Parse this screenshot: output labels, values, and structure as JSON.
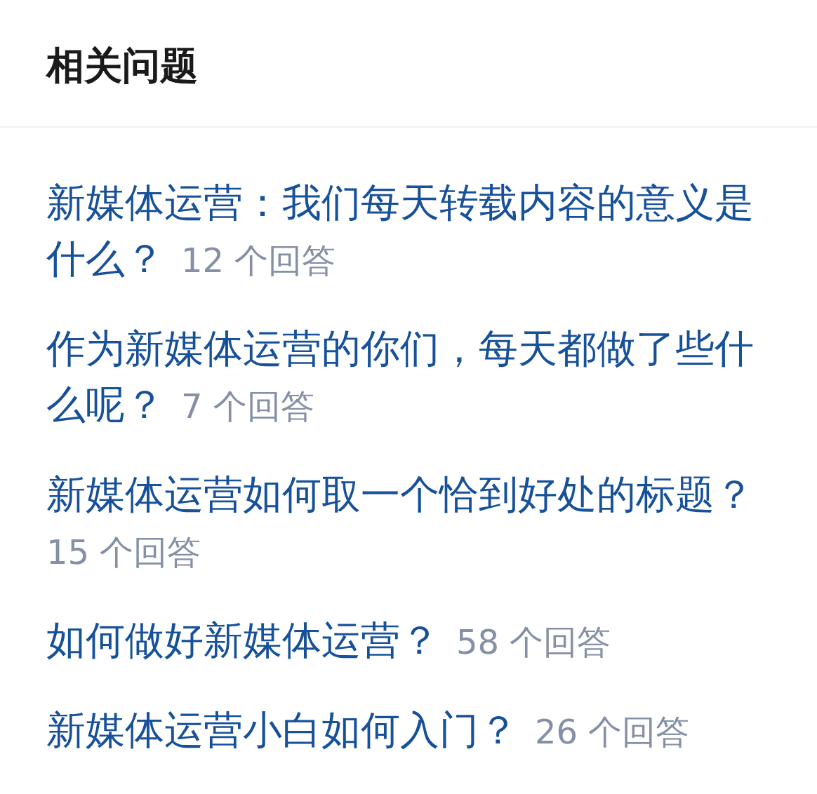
{
  "title": "相关问题",
  "questions": [
    {
      "title": "新媒体运营：我们每天转载内容的意义是什么？",
      "answers": "12 个回答"
    },
    {
      "title": "作为新媒体运营的你们，每天都做了些什么呢？",
      "answers": "7 个回答"
    },
    {
      "title": "新媒体运营如何取一个恰到好处的标题？",
      "answers": "15 个回答"
    },
    {
      "title": "如何做好新媒体运营？",
      "answers": "58 个回答"
    },
    {
      "title": "新媒体运营小白如何入门？",
      "answers": "26 个回答"
    }
  ]
}
